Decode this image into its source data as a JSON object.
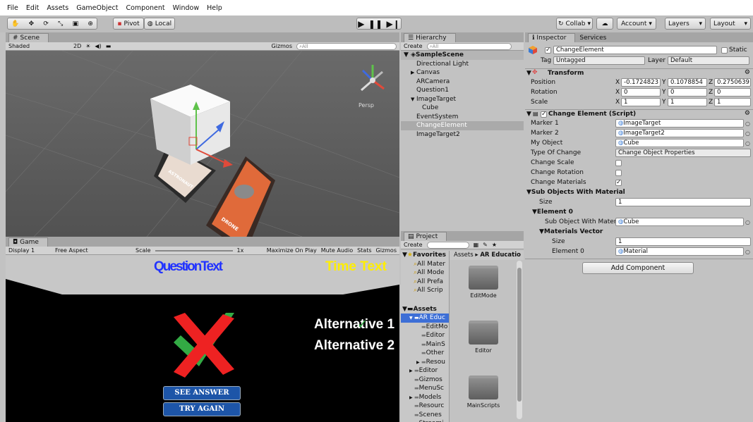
{
  "menu": [
    "File",
    "Edit",
    "Assets",
    "GameObject",
    "Component",
    "Window",
    "Help"
  ],
  "toolbar": {
    "pivot": "Pivot",
    "local": "Local",
    "collab": "Collab",
    "account": "Account",
    "layers": "Layers",
    "layout": "Layout"
  },
  "scene": {
    "tab": "Scene",
    "shading": "Shaded",
    "mode2d": "2D",
    "gizmos": "Gizmos",
    "search_placeholder": "All",
    "persp": "Persp",
    "card1_label": "ASTRONAUT",
    "card2_label": "DRONE"
  },
  "game": {
    "tab": "Game",
    "display": "Display 1",
    "aspect": "Free Aspect",
    "scale_label": "Scale",
    "scale_value": "1x",
    "maximize": "Maximize On Play",
    "mute": "Mute Audio",
    "stats": "Stats",
    "gizmos": "Gizmos",
    "question_text": "QuestionText",
    "time_text": "Time Text",
    "alt1": "Alternative 1",
    "alt2": "Alternative 2",
    "see_answer": "SEE ANSWER",
    "try_again": "TRY AGAIN"
  },
  "hierarchy": {
    "tab": "Hierarchy",
    "create": "Create",
    "search_placeholder": "All",
    "scene_name": "SampleScene",
    "items": [
      {
        "label": "Directional Light",
        "indent": 1,
        "arrow": ""
      },
      {
        "label": "Canvas",
        "indent": 1,
        "arrow": "▶"
      },
      {
        "label": "ARCamera",
        "indent": 1,
        "arrow": ""
      },
      {
        "label": "Question1",
        "indent": 1,
        "arrow": ""
      },
      {
        "label": "ImageTarget",
        "indent": 1,
        "arrow": "▼"
      },
      {
        "label": "Cube",
        "indent": 2,
        "arrow": ""
      },
      {
        "label": "EventSystem",
        "indent": 1,
        "arrow": ""
      },
      {
        "label": "ChangeElement",
        "indent": 1,
        "arrow": "",
        "selected": true
      },
      {
        "label": "ImageTarget2",
        "indent": 1,
        "arrow": ""
      }
    ]
  },
  "project": {
    "tab": "Project",
    "create": "Create",
    "favorites": "Favorites",
    "fav_items": [
      "All Mater",
      "All Mode",
      "All Prefa",
      "All Scrip"
    ],
    "assets": "Assets",
    "tree": [
      {
        "label": "AR Educ",
        "indent": 1,
        "arrow": "▼",
        "selected": true
      },
      {
        "label": "EditMo",
        "indent": 2,
        "arrow": ""
      },
      {
        "label": "Editor",
        "indent": 2,
        "arrow": ""
      },
      {
        "label": "MainS",
        "indent": 2,
        "arrow": ""
      },
      {
        "label": "Other",
        "indent": 2,
        "arrow": ""
      },
      {
        "label": "Resou",
        "indent": 2,
        "arrow": "▶"
      },
      {
        "label": "Editor",
        "indent": 1,
        "arrow": "▶"
      },
      {
        "label": "Gizmos",
        "indent": 1,
        "arrow": ""
      },
      {
        "label": "MenuSc",
        "indent": 1,
        "arrow": ""
      },
      {
        "label": "Models",
        "indent": 1,
        "arrow": "▶"
      },
      {
        "label": "Resourc",
        "indent": 1,
        "arrow": ""
      },
      {
        "label": "Scenes",
        "indent": 1,
        "arrow": ""
      },
      {
        "label": "Streami",
        "indent": 1,
        "arrow": "▶"
      }
    ],
    "breadcrumb": [
      "Assets",
      "AR Educatio"
    ],
    "folders": [
      "EditMode",
      "Editor",
      "MainScripts"
    ]
  },
  "inspector": {
    "tab": "Inspector",
    "tab2": "Services",
    "object_name": "ChangeElement",
    "static": "Static",
    "tag_label": "Tag",
    "tag_value": "Untagged",
    "layer_label": "Layer",
    "layer_value": "Default",
    "transform": {
      "title": "Transform",
      "position": {
        "label": "Position",
        "x": "-0.1724823",
        "y": "0.1078854",
        "z": "0.2750639"
      },
      "rotation": {
        "label": "Rotation",
        "x": "0",
        "y": "0",
        "z": "0"
      },
      "scale": {
        "label": "Scale",
        "x": "1",
        "y": "1",
        "z": "1"
      }
    },
    "script": {
      "title": "Change Element (Script)",
      "marker1_label": "Marker 1",
      "marker1_value": "ImageTarget",
      "marker2_label": "Marker 2",
      "marker2_value": "ImageTarget2",
      "myobject_label": "My Object",
      "myobject_value": "Cube",
      "type_label": "Type Of Change",
      "type_value": "Change Object Properties",
      "scale_label": "Change Scale",
      "rotation_label": "Change Rotation",
      "materials_label": "Change Materials",
      "sub_objects_label": "Sub Objects With Material",
      "size_label": "Size",
      "size_value": "1",
      "element0_label": "Element 0",
      "sub_object_label": "Sub Object With Material",
      "sub_object_value": "Cube",
      "materials_vector_label": "Materials Vector",
      "mv_size_label": "Size",
      "mv_size_value": "1",
      "mv_element_label": "Element 0",
      "mv_element_value": "Material"
    },
    "add_component": "Add Component"
  },
  "colors": {
    "selected": "#3d6fd6",
    "question_blue": "#2233ff",
    "time_yellow": "#ffee00",
    "button_blue": "#1d55a8",
    "cross_red": "#ee2222",
    "check_green": "#33aa44"
  }
}
